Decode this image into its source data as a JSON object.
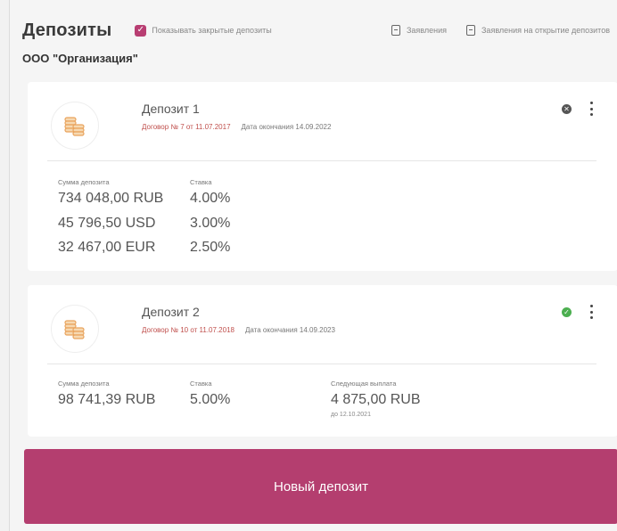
{
  "header": {
    "title": "Депозиты",
    "show_closed_label": "Показывать закрытые депозиты",
    "statements_label": "Заявления",
    "open_statements_label": "Заявления на открытие депозитов"
  },
  "organization": "ООО \"Организация\"",
  "deposits": [
    {
      "name": "Депозит 1",
      "contract": "Договор № 7 от 11.07.2017",
      "end_date": "Дата окончания 14.09.2022",
      "status": "closed",
      "amount_label": "Сумма депозита",
      "rate_label": "Ставка",
      "rows": [
        {
          "amount": "734 048,00 RUB",
          "rate": "4.00%"
        },
        {
          "amount": "45 796,50 USD",
          "rate": "3.00%"
        },
        {
          "amount": "32 467,00 EUR",
          "rate": "2.50%"
        }
      ]
    },
    {
      "name": "Депозит 2",
      "contract": "Договор № 10 от 11.07.2018",
      "end_date": "Дата окончания 14.09.2023",
      "status": "active",
      "amount_label": "Сумма депозита",
      "rate_label": "Ставка",
      "next_payment_label": "Следующая выплата",
      "rows": [
        {
          "amount": "98 741,39 RUB",
          "rate": "5.00%"
        }
      ],
      "next_payment": "4 875,00 RUB",
      "next_payment_date": "до 12.10.2021"
    }
  ],
  "new_deposit_label": "Новый депозит",
  "colors": {
    "accent": "#b43e6f",
    "contract_link": "#c0504d",
    "status_active": "#4caf50",
    "status_closed": "#555555"
  },
  "icons": {
    "deposit": "coins-icon",
    "document": "document-icon",
    "menu": "kebab-menu-icon"
  }
}
